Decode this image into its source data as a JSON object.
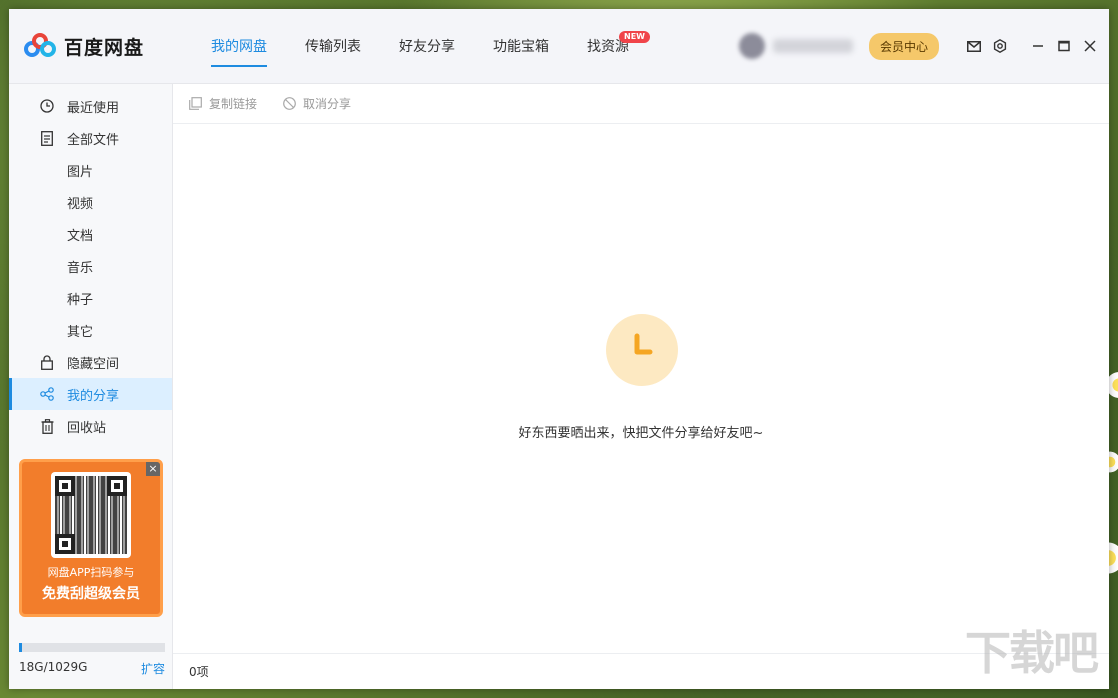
{
  "app": {
    "name": "百度网盘"
  },
  "nav": {
    "tabs": [
      {
        "label": "我的网盘",
        "active": true
      },
      {
        "label": "传输列表"
      },
      {
        "label": "好友分享"
      },
      {
        "label": "功能宝箱"
      },
      {
        "label": "找资源",
        "badge": "NEW"
      }
    ]
  },
  "header": {
    "vip_label": "会员中心"
  },
  "sidebar": {
    "items": [
      {
        "label": "最近使用",
        "icon": "clock-icon"
      },
      {
        "label": "全部文件",
        "icon": "file-icon"
      },
      {
        "label": "图片"
      },
      {
        "label": "视频"
      },
      {
        "label": "文档"
      },
      {
        "label": "音乐"
      },
      {
        "label": "种子"
      },
      {
        "label": "其它"
      },
      {
        "label": "隐藏空间",
        "icon": "lock-icon"
      },
      {
        "label": "我的分享",
        "icon": "share-icon",
        "active": true
      },
      {
        "label": "回收站",
        "icon": "trash-icon"
      }
    ],
    "promo": {
      "close": "×",
      "line1": "网盘APP扫码参与",
      "line2": "免费刮超级会员"
    },
    "storage": {
      "text": "18G/1029G",
      "used_fraction": 0.0175,
      "expand_label": "扩容"
    }
  },
  "toolbar": {
    "copy_link": "复制链接",
    "cancel_share": "取消分享"
  },
  "content": {
    "empty_message": "好东西要晒出来，快把文件分享给好友吧~"
  },
  "footer": {
    "count": "0项"
  },
  "watermark": {
    "text": "下载吧"
  },
  "colors": {
    "accent": "#1e8be0",
    "vip": "#f5c86a",
    "promo": "#f27d2b",
    "empty_art": "#fde9c2",
    "empty_icon": "#f5a623"
  }
}
